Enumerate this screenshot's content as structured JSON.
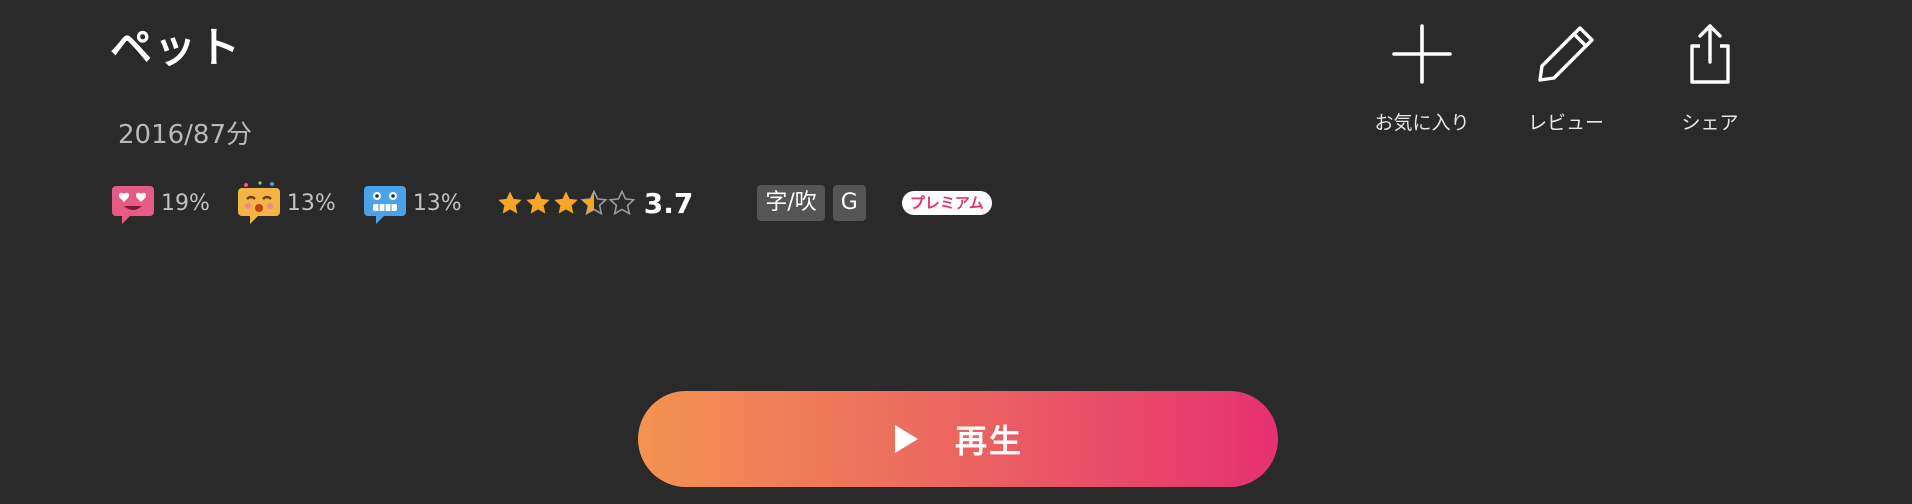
{
  "title": "ペット",
  "meta": "2016/87分",
  "emotions": [
    {
      "icon": "heart-eyes-emoji-icon",
      "percent": "19%",
      "color": "#e85a86"
    },
    {
      "icon": "party-emoji-icon",
      "percent": "13%",
      "color": "#f5b447"
    },
    {
      "icon": "grimace-emoji-icon",
      "percent": "13%",
      "color": "#4aa3e8"
    }
  ],
  "rating": {
    "value": "3.7",
    "stars": [
      1,
      1,
      1,
      0.5,
      0
    ],
    "star_color": "#f6a623"
  },
  "badges": [
    "字/吹",
    "G"
  ],
  "premium_label": "プレミアム",
  "actions": {
    "favorite_label": "お気に入り",
    "review_label": "レビュー",
    "share_label": "シェア"
  },
  "play": {
    "label": "再生",
    "gradient": [
      "#f39351",
      "#e63071"
    ]
  }
}
